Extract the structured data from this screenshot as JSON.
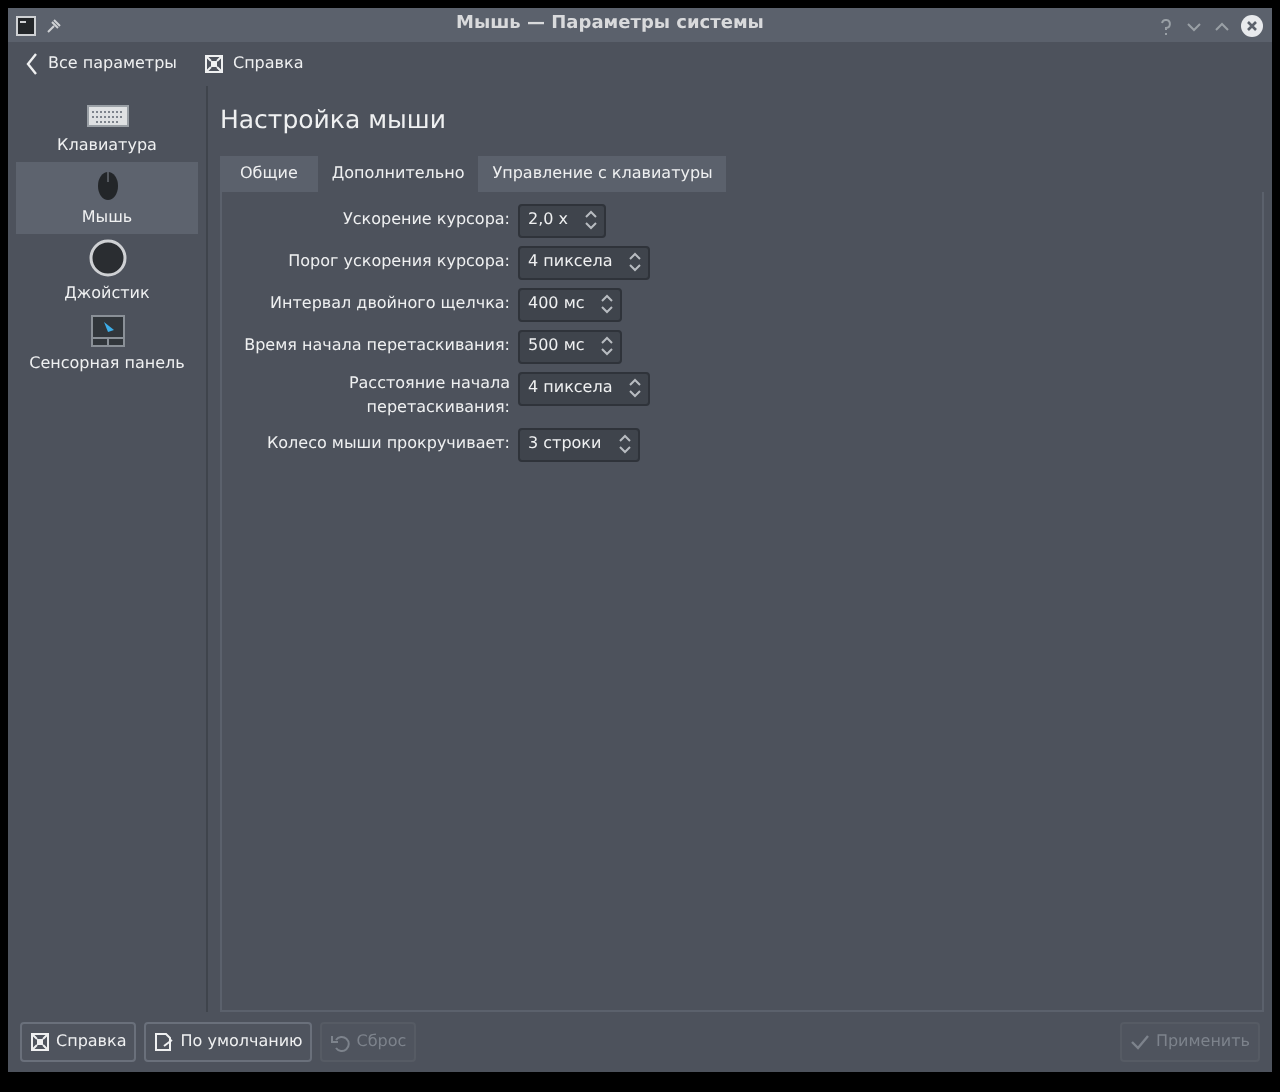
{
  "window": {
    "title": "Мышь  — Параметры системы"
  },
  "toolbar": [
    {
      "kind": "back",
      "label": "Все параметры"
    },
    {
      "kind": "help",
      "label": "Справка"
    }
  ],
  "sidebar": {
    "items": [
      {
        "kind": "keyboard",
        "label": "Клавиатура",
        "selected": false
      },
      {
        "kind": "mouse",
        "label": "Мышь",
        "selected": true
      },
      {
        "kind": "joystick",
        "label": "Джойстик",
        "selected": false
      },
      {
        "kind": "touchpad",
        "label": "Сенсорная панель",
        "selected": false
      }
    ]
  },
  "heading": "Настройка мыши",
  "tabs": [
    {
      "label": "Общие",
      "selected": false
    },
    {
      "label": "Дополнительно",
      "selected": true
    },
    {
      "label": "Управление с клавиатуры",
      "selected": false
    }
  ],
  "fields": [
    {
      "label": "Ускорение курсора:",
      "value": "2,0 x"
    },
    {
      "label": "Порог ускорения курсора:",
      "value": "4 пиксела"
    },
    {
      "label": "Интервал двойного щелчка:",
      "value": "400 мс"
    },
    {
      "label": "Время начала перетаскивания:",
      "value": "500 мс"
    },
    {
      "label": "Расстояние начала перетаскивания:",
      "value": "4 пиксела"
    },
    {
      "label": "Колесо мыши прокручивает:",
      "value": "3 строки"
    }
  ],
  "footer": [
    {
      "kind": "help",
      "label": "Справка",
      "disabled": false
    },
    {
      "kind": "defaults",
      "label": "По умолчанию",
      "disabled": false
    },
    {
      "kind": "reset",
      "label": "Сброс",
      "disabled": true
    },
    {
      "kind": "apply",
      "label": "Применить",
      "disabled": true
    }
  ]
}
